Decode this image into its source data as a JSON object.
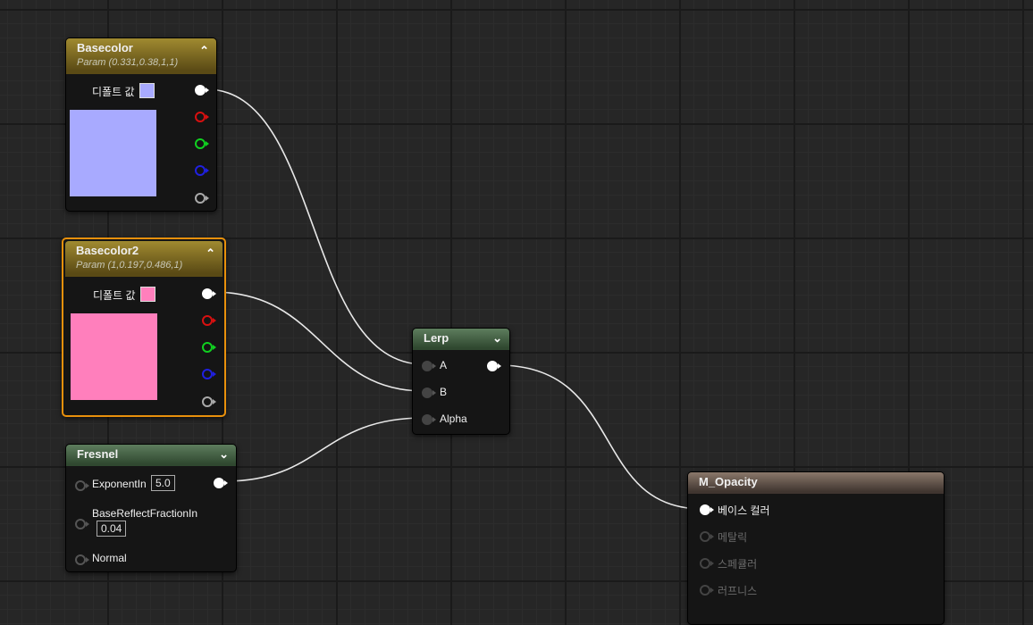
{
  "wires_color": "#e8e8e8",
  "nodes": {
    "basecolor": {
      "title": "Basecolor",
      "subtitle": "Param (0.331,0.38,1,1)",
      "default_label": "디폴트 값",
      "color": "#a8aaff"
    },
    "basecolor2": {
      "title": "Basecolor2",
      "subtitle": "Param (1,0.197,0.486,1)",
      "default_label": "디폴트 값",
      "color": "#ff7fbc"
    },
    "fresnel": {
      "title": "Fresnel",
      "exponent_label": "ExponentIn",
      "exponent_value": "5.0",
      "base_reflect_label": "BaseReflectFractionIn",
      "base_reflect_value": "0.04",
      "normal_label": "Normal"
    },
    "lerp": {
      "title": "Lerp",
      "input_a": "A",
      "input_b": "B",
      "input_alpha": "Alpha"
    },
    "material": {
      "title": "M_Opacity",
      "inputs": [
        "베이스 컬러",
        "메탈릭",
        "스페큘러",
        "러프니스"
      ]
    }
  }
}
